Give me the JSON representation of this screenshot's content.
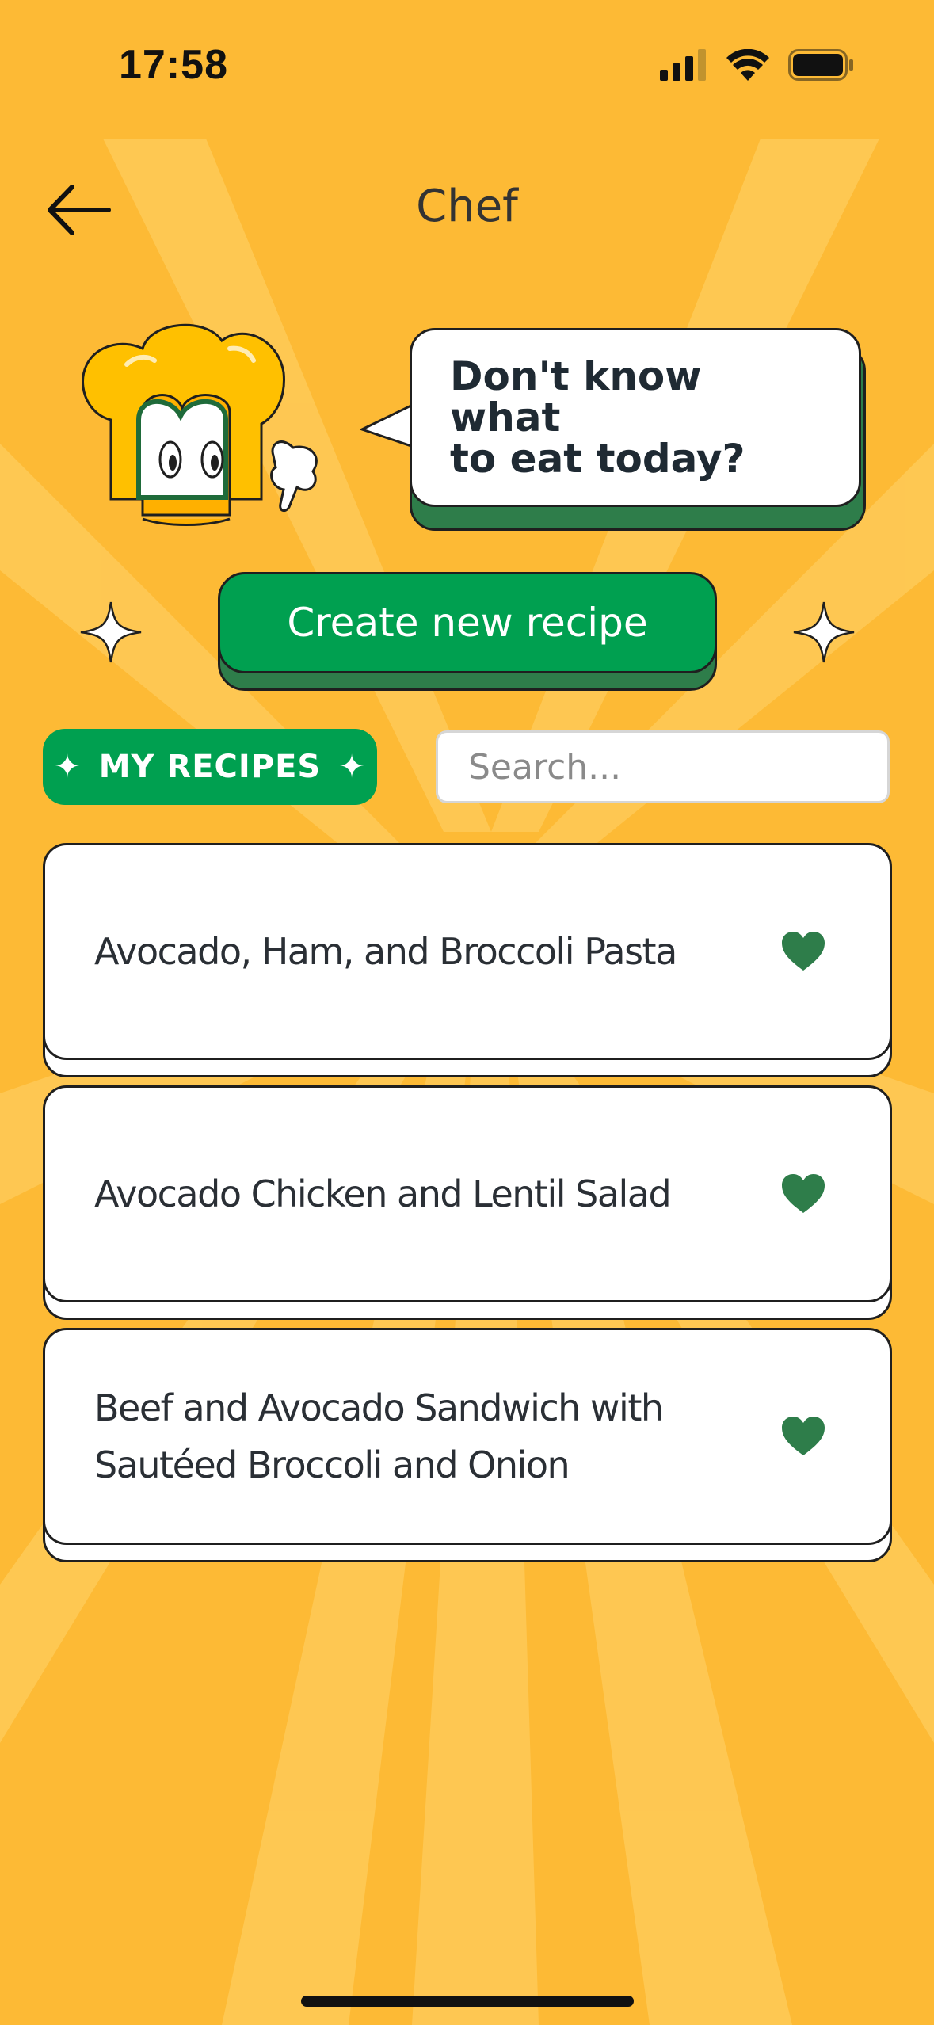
{
  "status": {
    "time": "17:58"
  },
  "header": {
    "title": "Chef"
  },
  "bubble": {
    "text": "Don't know what\nto eat today?"
  },
  "create": {
    "label": "Create new recipe"
  },
  "section": {
    "label": "MY RECIPES",
    "star": "✦"
  },
  "search": {
    "placeholder": "Search..."
  },
  "recipes": [
    {
      "title": "Avocado, Ham, and Broccoli Pasta",
      "favorite": true
    },
    {
      "title": "Avocado Chicken and Lentil Salad",
      "favorite": true
    },
    {
      "title": "Beef and Avocado Sandwich with Sautéed Broccoli and Onion",
      "favorite": true
    }
  ],
  "colors": {
    "background": "#FDBA35",
    "primary_green": "#00A050",
    "shadow_green": "#2E7D4A",
    "heart": "#2E7D4A"
  }
}
